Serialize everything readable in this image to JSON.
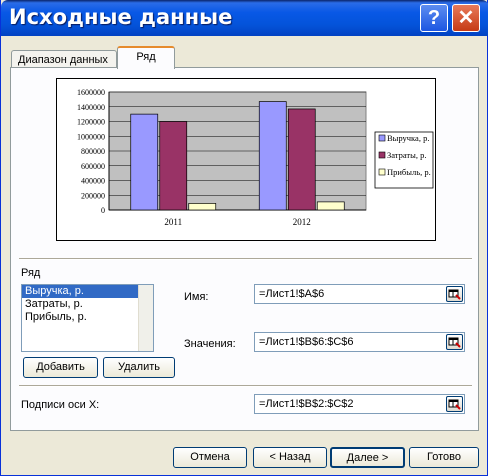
{
  "window": {
    "title": "Исходные данные",
    "help_label": "?",
    "close_label": "✕"
  },
  "tabs": [
    {
      "label": "Диапазон данных",
      "active": false
    },
    {
      "label": "Ряд",
      "active": true
    }
  ],
  "chart_data": {
    "type": "bar",
    "categories": [
      "2011",
      "2012"
    ],
    "series": [
      {
        "name": "Выручка, р.",
        "values": [
          1300000,
          1470000
        ],
        "color": "#9999ff"
      },
      {
        "name": "Затраты, р.",
        "values": [
          1200000,
          1370000
        ],
        "color": "#993366"
      },
      {
        "name": "Прибыль, р.",
        "values": [
          90000,
          110000
        ],
        "color": "#ffffcc"
      }
    ],
    "ylim": [
      0,
      1600000
    ],
    "yticks": [
      "1600000",
      "1400000",
      "1200000",
      "1000000",
      "800000",
      "600000",
      "400000",
      "200000",
      "0"
    ],
    "plot_background": "#c0c0c0",
    "grid": true,
    "legend": "right"
  },
  "series_section": {
    "label": "Ряд",
    "items": [
      "Выручка, р.",
      "Затраты, р.",
      "Прибыль, р."
    ],
    "selected_index": 0,
    "add_label": "Добавить",
    "remove_label": "Удалить"
  },
  "fields": {
    "name_label": "Имя:",
    "name_value": "=Лист1!$A$6",
    "values_label": "Значения:",
    "values_value": "=Лист1!$B$6:$C$6",
    "xaxis_label": "Подписи оси X:",
    "xaxis_value": "=Лист1!$B$2:$C$2"
  },
  "footer": {
    "cancel": "Отмена",
    "back": "< Назад",
    "next": "Далее >",
    "finish": "Готово"
  }
}
